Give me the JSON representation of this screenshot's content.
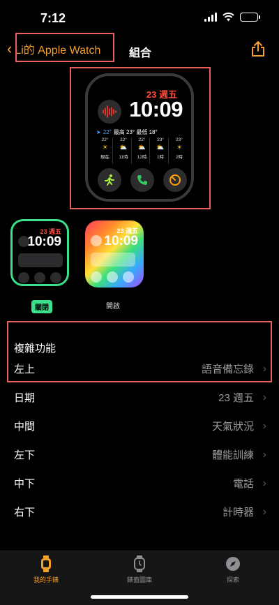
{
  "status": {
    "time": "7:12"
  },
  "nav": {
    "back_label": "Li的 Apple Watch",
    "title": "組合"
  },
  "watch_face": {
    "date": "23 週五",
    "time": "10:09",
    "weather": {
      "current": "22°",
      "summary": "最高 23° 最低 18°"
    },
    "hourly": [
      {
        "temp": "22°",
        "label": "現在"
      },
      {
        "temp": "22°",
        "label": "11時"
      },
      {
        "temp": "22°",
        "label": "12時"
      },
      {
        "temp": "23°",
        "label": "1時"
      },
      {
        "temp": "23°",
        "label": "2時"
      }
    ]
  },
  "faces": [
    {
      "date": "23 週五",
      "time": "10:09",
      "label": "關閉"
    },
    {
      "date": "23 週五",
      "time": "10:09",
      "label": "開啟"
    }
  ],
  "section": {
    "title": "複雜功能"
  },
  "complications": [
    {
      "position": "左上",
      "value": "語音備忘錄"
    },
    {
      "position": "日期",
      "value": "23 週五"
    },
    {
      "position": "中間",
      "value": "天氣狀況"
    },
    {
      "position": "左下",
      "value": "體能訓練"
    },
    {
      "position": "中下",
      "value": "電話"
    },
    {
      "position": "右下",
      "value": "計時器"
    }
  ],
  "tabs": [
    {
      "label": "我的手錶"
    },
    {
      "label": "錶面圖庫"
    },
    {
      "label": "探索"
    }
  ],
  "colors": {
    "accent": "#f59e2a",
    "highlight": "#e8605c",
    "selected": "#3ae08a",
    "date_red": "#ff4a3d"
  }
}
